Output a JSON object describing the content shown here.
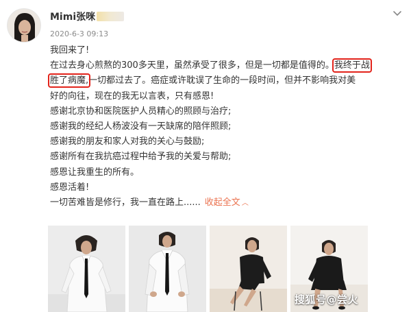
{
  "post": {
    "author": "Mimi张咪",
    "timestamp": "2020-6-3 09:13",
    "line1": "我回来了!",
    "line2a": "在过去身心煎熬的300多天里，虽然承受了很多，但是一切都是值得的。",
    "line2b": "我终于战",
    "line3a": "胜了病魔,",
    "line3b": "一切都过去了。癌症或许耽误了生命的一段时间，但并不影响我对美",
    "line4": "好的向往，现在的我无以言表，只有感恩!",
    "line5": "感谢北京协和医院医护人员精心的照顾与治疗;",
    "line6": "感谢我的经纪人杨波没有一天缺席的陪伴照顾;",
    "line7": "感谢我的朋友和家人对我的关心与鼓励;",
    "line8": "感谢所有在我抗癌过程中给予我的关爱与帮助;",
    "line9": "感恩让我重生的所有。",
    "line10": "感恩活着!",
    "line11": "一切苦难皆是修行，我一直在路上......",
    "expand_label": "收起全文",
    "expand_icon": "chevron-up-icon",
    "menu_icon": "chevron-down-icon"
  },
  "watermark": "搜狐号@尝火",
  "colors": {
    "link": "#eb7350",
    "highlight": "#e2231a",
    "text": "#333333",
    "meta": "#8a8a8a"
  }
}
